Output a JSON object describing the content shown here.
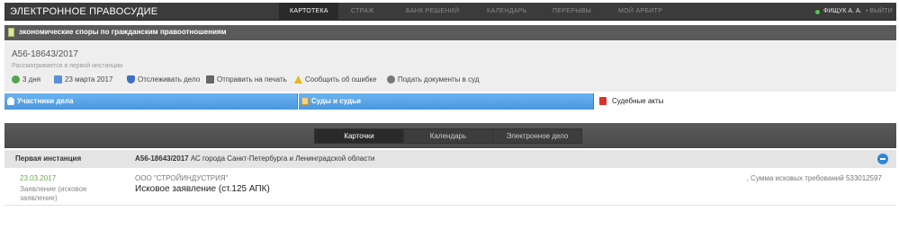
{
  "header": {
    "brand": "ЭЛЕКТРОННОЕ ПРАВОСУДИЕ",
    "nav": [
      "КАРТОТЕКА",
      "СТРАЖ",
      "БАНК РЕШЕНИЙ",
      "КАЛЕНДАРЬ",
      "ПЕРЕРЫВЫ",
      "МОЙ АРБИТР"
    ],
    "active_nav": "КАРТОТЕКА",
    "user": "ФИЩУК А. А.",
    "logout": "• ВЫЙТИ",
    "online_color": "#4cc64c"
  },
  "category": {
    "icon": "document-icon",
    "label": "экономические споры по гражданским правоотношениям"
  },
  "case": {
    "number": "А56-18643/2017",
    "status": "Рассматривается в первой инстанции",
    "tools": [
      {
        "icon": "clock-icon",
        "label": "3 дня"
      },
      {
        "icon": "calendar-icon",
        "label": "23 марта 2017"
      },
      {
        "icon": "shield-icon",
        "label": "Отслеживать дело"
      },
      {
        "icon": "printer-icon",
        "label": "Отправить на печать"
      },
      {
        "icon": "warning-icon",
        "label": "Сообщить об ошибке"
      },
      {
        "icon": "gear-icon",
        "label": "Подать документы в суд"
      }
    ]
  },
  "tabs": [
    {
      "icon": "users-icon",
      "label": "Участники дела"
    },
    {
      "icon": "court-icon",
      "label": "Суды и судьи"
    },
    {
      "icon": "pdf-icon",
      "label": "Судебные акты"
    }
  ],
  "switcher": [
    "Карточки",
    "Календарь",
    "Электронное дело"
  ],
  "instance": {
    "label": "Первая инстанция",
    "case_number": "А56-18643/2017",
    "court": "АС города Санкт-Петербурга и Ленинградской области"
  },
  "document": {
    "date": "23.03.2017",
    "type": "Заявление (исковое заявление)",
    "organization": "ООО \"СТРОЙИНДУСТРИЯ\"",
    "title": "Исковое заявление (ст.125 АПК)",
    "claim_sum": ", Сумма исковых требований 533012597"
  },
  "colors": {
    "accent_blue": "#4a97dd",
    "date_green": "#6aa84f",
    "topbar": "#3b3b3b"
  }
}
